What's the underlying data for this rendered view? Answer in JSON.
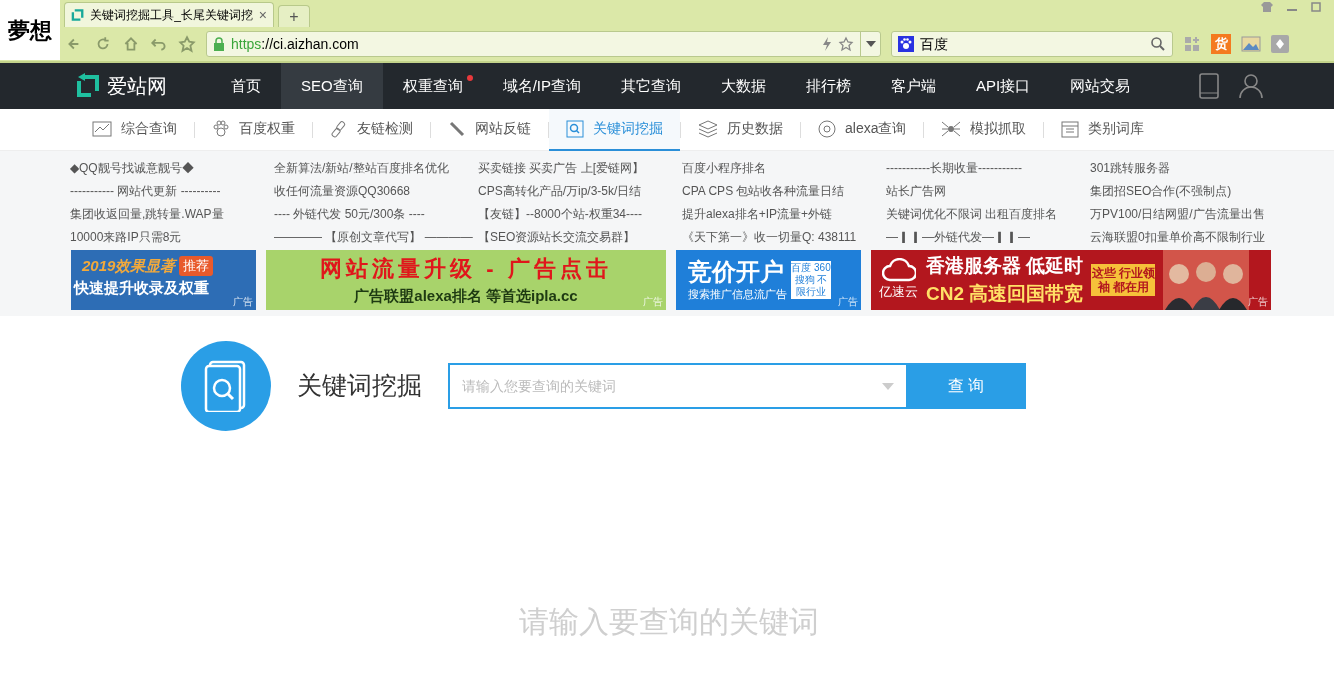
{
  "browser": {
    "logo_text": "夢想",
    "tab_title": "关键词挖掘工具_长尾关键词挖",
    "tab_close": "×",
    "new_tab": "+",
    "url_scheme": "https",
    "url_rest": "://ci.aizhan.com",
    "search_engine": "百度",
    "ext_badge": "货"
  },
  "site": {
    "brand": "爱站网",
    "nav": [
      {
        "label": "首页",
        "selected": false,
        "dot": false
      },
      {
        "label": "SEO查询",
        "selected": true,
        "dot": false
      },
      {
        "label": "权重查询",
        "selected": false,
        "dot": true
      },
      {
        "label": "域名/IP查询",
        "selected": false,
        "dot": false
      },
      {
        "label": "其它查询",
        "selected": false,
        "dot": false
      },
      {
        "label": "大数据",
        "selected": false,
        "dot": false
      },
      {
        "label": "排行榜",
        "selected": false,
        "dot": false
      },
      {
        "label": "客户端",
        "selected": false,
        "dot": false
      },
      {
        "label": "API接口",
        "selected": false,
        "dot": false
      },
      {
        "label": "网站交易",
        "selected": false,
        "dot": false
      }
    ],
    "subnav": [
      {
        "label": "综合查询",
        "selected": false
      },
      {
        "label": "百度权重",
        "selected": false
      },
      {
        "label": "友链检测",
        "selected": false
      },
      {
        "label": "网站反链",
        "selected": false
      },
      {
        "label": "关键词挖掘",
        "selected": true
      },
      {
        "label": "历史数据",
        "selected": false
      },
      {
        "label": "alexa查询",
        "selected": false
      },
      {
        "label": "模拟抓取",
        "selected": false
      },
      {
        "label": "类别词库",
        "selected": false
      }
    ],
    "link_rows": [
      [
        "◆QQ靓号找诚意靓号◆",
        "全新算法/新站/整站百度排名优化",
        "买卖链接 买卖广告 上[爱链网】",
        "百度小程序排名",
        "-----------长期收量-----------",
        "301跳转服务器"
      ],
      [
        "----------- 网站代更新 ----------",
        "收任何流量资源QQ30668",
        "CPS高转化产品/万ip/3-5k/日结",
        "CPA CPS 包站收各种流量日结",
        "站长广告网",
        "集团招SEO合作(不强制点)"
      ],
      [
        "集团收返回量,跳转量.WAP量",
        "---- 外链代发 50元/300条 ----",
        "【友链】--8000个站-权重34----",
        "提升alexa排名+IP流量+外链",
        "关键词优化不限词 出租百度排名",
        "万PV100/日结网盟/广告流量出售"
      ],
      [
        "10000来路IP只需8元",
        "———— 【原创文章代写】 ————",
        "【SEO资源站长交流交易群】",
        "《天下第一》收一切量Q: 438111",
        "—▎▎—外链代发—▎▎—",
        "云海联盟0扣量单价高不限制行业"
      ]
    ],
    "banners": [
      {
        "kind": "promo",
        "lines": [
          "2019效果显著",
          "推荐",
          "快速提升收录及权重"
        ],
        "tag": "广告"
      },
      {
        "kind": "traffic",
        "lines": [
          "网站流量升级 - 广告点击",
          "广告联盟alexa排名 等首选ipla.cc"
        ],
        "tag": "广告"
      },
      {
        "kind": "bidding",
        "lines": [
          "竞价开户",
          "搜索推广信息流广告",
          "百度 360 搜狗 不限行业"
        ],
        "tag": "广告"
      },
      {
        "kind": "server",
        "lines": [
          "亿速云",
          "香港服务器 低延时",
          "CN2 高速回国带宽",
          "这些 行业领袖 都在用"
        ],
        "tag": "广告"
      }
    ],
    "search": {
      "title": "关键词挖掘",
      "placeholder": "请输入您要查询的关键词",
      "button": "查 询",
      "hint": "请输入要查询的关键词"
    }
  }
}
